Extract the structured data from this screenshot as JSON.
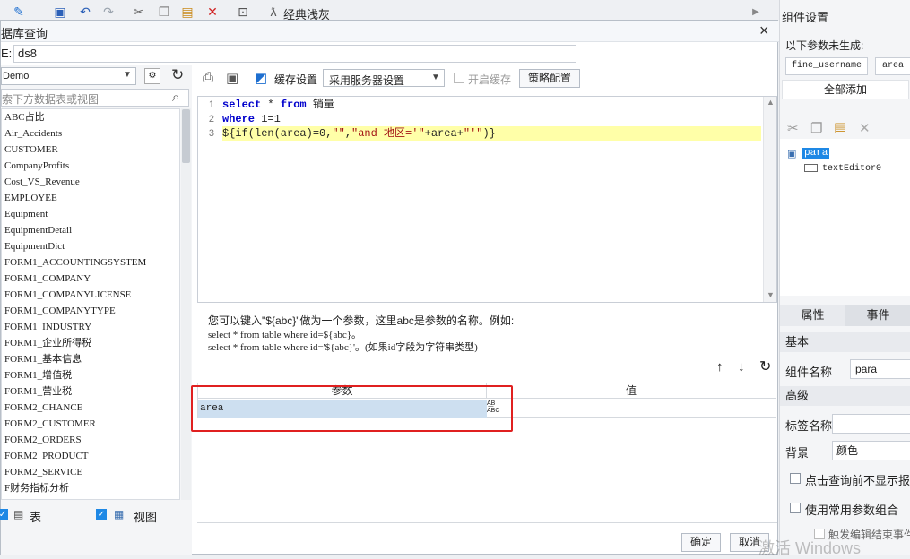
{
  "toolbar": {
    "theme_label": "经典浅灰"
  },
  "dialog": {
    "title": "据库查询",
    "name_label": "E:",
    "name_value": "ds8",
    "close_glyph": "×",
    "ok_label": "确定",
    "cancel_label": "取消"
  },
  "left": {
    "connection": "Demo",
    "search_placeholder": "索下方数据表或视图",
    "tables": [
      "ABC占比",
      "Air_Accidents",
      "CUSTOMER",
      "CompanyProfits",
      "Cost_VS_Revenue",
      "EMPLOYEE",
      "Equipment",
      "EquipmentDetail",
      "EquipmentDict",
      "FORM1_ACCOUNTINGSYSTEM",
      "FORM1_COMPANY",
      "FORM1_COMPANYLICENSE",
      "FORM1_COMPANYTYPE",
      "FORM1_INDUSTRY",
      "FORM1_企业所得税",
      "FORM1_基本信息",
      "FORM1_增值税",
      "FORM1_营业税",
      "FORM2_CHANCE",
      "FORM2_CUSTOMER",
      "FORM2_ORDERS",
      "FORM2_PRODUCT",
      "FORM2_SERVICE",
      "F财务指标分析"
    ],
    "show_tables_label": "表",
    "show_views_label": "视图"
  },
  "query_toolbar": {
    "cache_settings_label": "缓存设置",
    "cache_mode": "采用服务器设置",
    "enable_cache_label": "开启缓存",
    "strategy_label": "策略配置"
  },
  "editor": {
    "line_numbers": [
      "1",
      "2",
      "3"
    ],
    "line1": {
      "kw1": "select",
      "mid": " * ",
      "kw2": "from",
      "rest": " 销量"
    },
    "line2": {
      "kw1": "where",
      "rest": " 1=1"
    },
    "line3": {
      "a": "${if(len(area)=0,",
      "b": "\"\"",
      "c": ",",
      "d": "\"and 地区='\"",
      "e": "+area+",
      "f": "\"'\"",
      "g": ")}"
    }
  },
  "help": {
    "line1": "您可以键入\"${abc}\"做为一个参数，这里abc是参数的名称。例如:",
    "line2": "select * from table where id=${abc}。",
    "line3": "select * from table where id='${abc}'。(如果id字段为字符串类型)"
  },
  "params": {
    "col_param": "参数",
    "col_value": "值",
    "rows": [
      {
        "name": "area",
        "value": ""
      }
    ],
    "type_glyph": "A͟B",
    "type_sub": "ABC"
  },
  "right": {
    "title": "组件设置",
    "ungenerated_label": "以下参数未生成:",
    "param_tags": [
      "fine_username",
      "area"
    ],
    "add_all_label": "全部添加",
    "tree_root": "para",
    "tree_child": "textEditor0",
    "tab_props": "属性",
    "tab_events": "事件",
    "sec_basic": "基本",
    "widget_name_label": "组件名称",
    "widget_name_value": "para",
    "sec_advanced": "高级",
    "tag_name_label": "标签名称",
    "bg_label": "背景",
    "bg_value": "颜色",
    "opt1": "点击查询前不显示报表",
    "opt2": "使用常用参数组合",
    "opt3": "触发编辑结束事件"
  },
  "watermark": "激活 Windows",
  "colors": {
    "accent": "#1e88e5",
    "highlight_line": "#ffffa8",
    "param_row": "#cddff0",
    "red_box": "#e02020"
  }
}
